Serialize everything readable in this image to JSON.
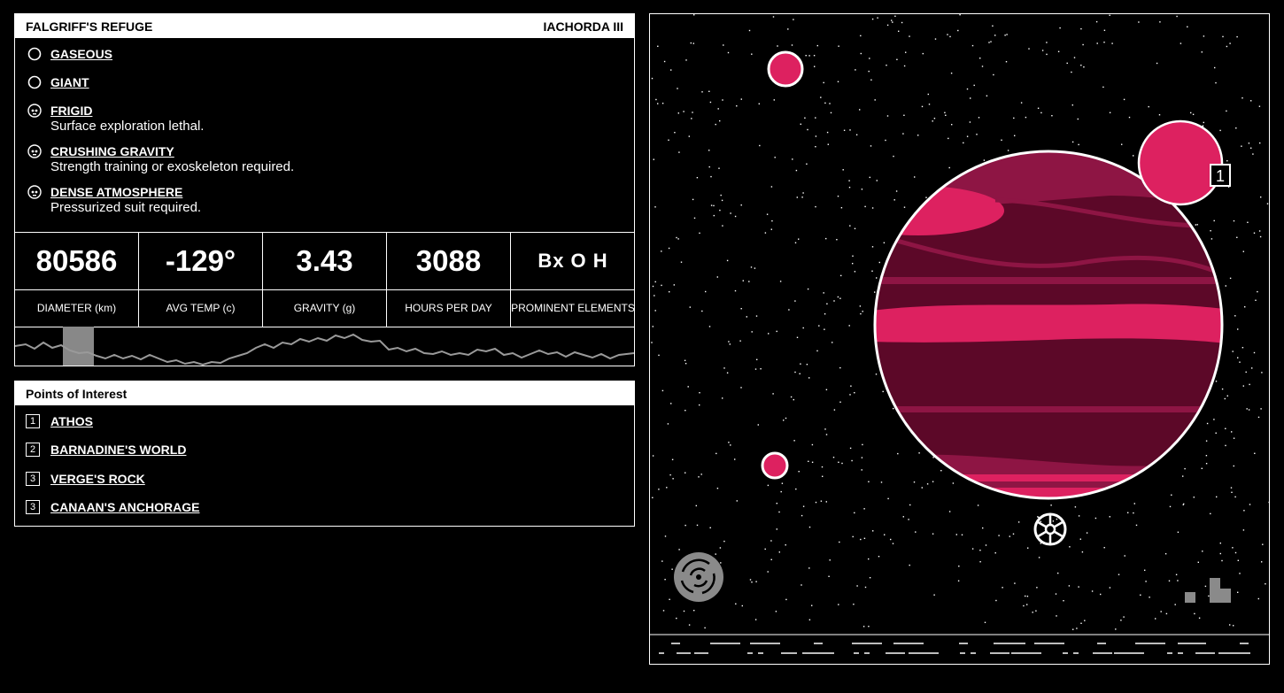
{
  "planet": {
    "name": "FALGRIFF'S REFUGE",
    "system": "IACHORDA III"
  },
  "traits": [
    {
      "icon": "circle-icon",
      "name": "GASEOUS",
      "desc": ""
    },
    {
      "icon": "circle-icon",
      "name": "GIANT",
      "desc": ""
    },
    {
      "icon": "skull-icon",
      "name": "FRIGID",
      "desc": "Surface exploration lethal."
    },
    {
      "icon": "skull-icon",
      "name": "CRUSHING GRAVITY",
      "desc": "Strength training or exoskeleton required."
    },
    {
      "icon": "skull-icon",
      "name": "DENSE ATMOSPHERE",
      "desc": "Pressurized suit required."
    }
  ],
  "stats": [
    {
      "value": "80586",
      "label": "DIAMETER (km)"
    },
    {
      "value": "-129°",
      "label": "AVG TEMP (c)"
    },
    {
      "value": "3.43",
      "label": "GRAVITY (g)"
    },
    {
      "value": "3088",
      "label": "HOURS PER DAY"
    },
    {
      "value": "Bx O H",
      "label": "PROMINENT ELEMENTS"
    }
  ],
  "poi": {
    "title": "Points of Interest",
    "items": [
      {
        "num": "1",
        "name": "ATHOS"
      },
      {
        "num": "2",
        "name": "BARNADINE'S WORLD"
      },
      {
        "num": "3",
        "name": "VERGE'S ROCK"
      },
      {
        "num": "3",
        "name": "CANAAN'S ANCHORAGE"
      }
    ]
  },
  "map": {
    "moon_label": "1"
  },
  "colors": {
    "accent": "#dd2160",
    "planet_dark": "#5c0828",
    "planet_mid": "#8e1544",
    "grey": "#8a8a8a"
  }
}
